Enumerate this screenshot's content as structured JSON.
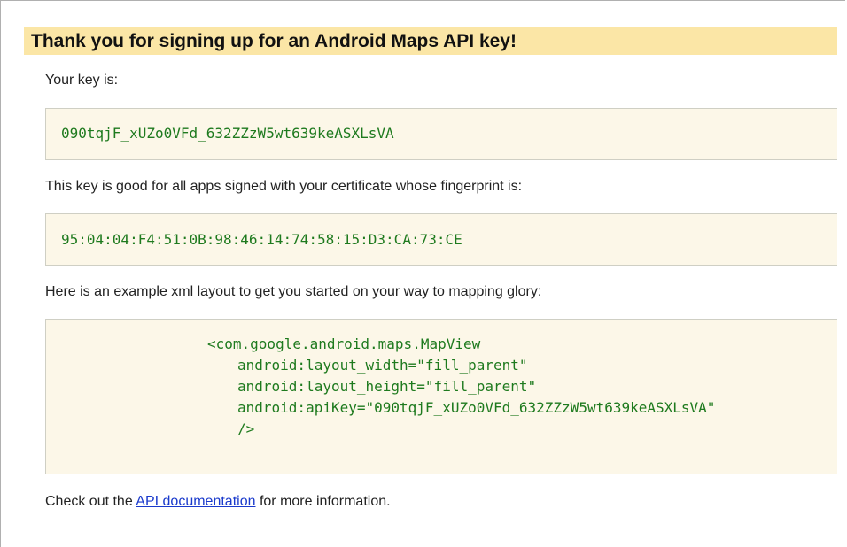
{
  "heading": "Thank you for signing up for an Android Maps API key!",
  "key_label": "Your key is:",
  "api_key": "090tqjF_xUZo0VFd_632ZZzW5wt639keASXLsVA",
  "fingerprint_label": "This key is good for all apps signed with your certificate whose fingerprint is:",
  "fingerprint": "95:04:04:F4:51:0B:98:46:14:74:58:15:D3:CA:73:CE",
  "example_label": "Here is an example xml layout to get you started on your way to mapping glory:",
  "xml_lines": [
    "<com.google.android.maps.MapView",
    "android:layout_width=\"fill_parent\"",
    "android:layout_height=\"fill_parent\"",
    "android:apiKey=\"090tqjF_xUZo0VFd_632ZZzW5wt639keASXLsVA\"",
    "/>"
  ],
  "footer": {
    "prefix": "Check out the ",
    "link_text": "API documentation",
    "suffix": " for more information."
  }
}
